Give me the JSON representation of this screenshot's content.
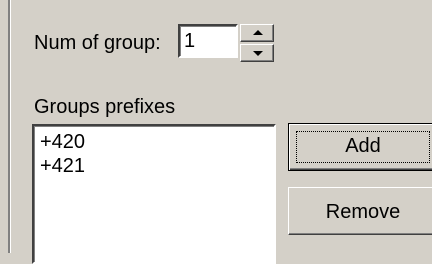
{
  "num_of_group": {
    "label": "Num of group:",
    "value": "1"
  },
  "groups_prefixes": {
    "label": "Groups prefixes",
    "items": [
      "+420",
      "+421"
    ]
  },
  "buttons": {
    "add_label": "Add",
    "remove_label": "Remove"
  },
  "icons": {
    "spin_up": "triangle-up-icon",
    "spin_down": "triangle-down-icon"
  },
  "colors": {
    "dialog_background": "#d4d0c8",
    "field_background": "#ffffff"
  }
}
